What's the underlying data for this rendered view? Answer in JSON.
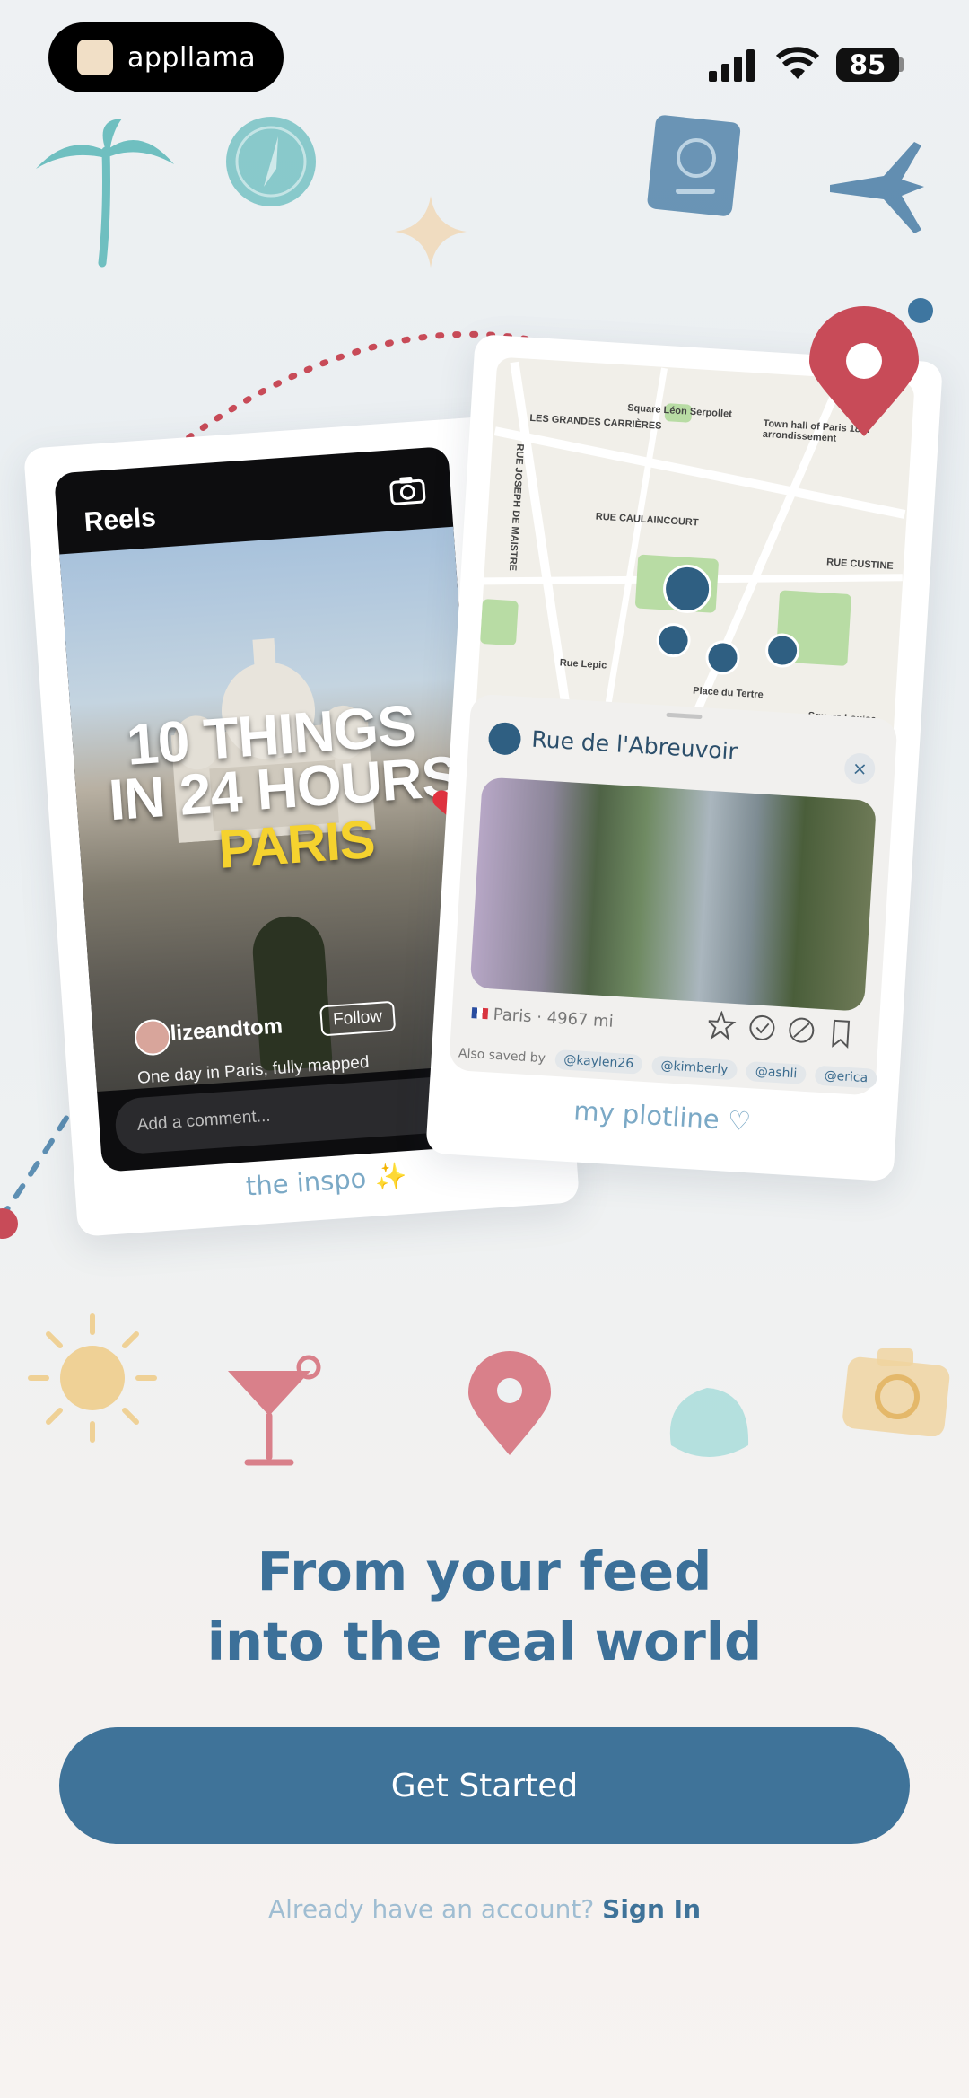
{
  "status_bar": {
    "app_name": "appllama",
    "battery": "85"
  },
  "inspo_card": {
    "reels_title": "Reels",
    "headline_line1": "10 THINGS",
    "headline_line2": "IN 24 HOURS",
    "headline_line3": "PARIS",
    "username": "lizeandtom",
    "follow_label": "Follow",
    "caption": "One day in Paris, fully mapped",
    "comment_placeholder": "Add a comment...",
    "label": "the inspo ✨"
  },
  "plot_card": {
    "map_labels": [
      "Square Léon Serpollet",
      "LES GRANDES CARRIÈRES",
      "Town hall of Paris 18th arrondissement",
      "RUE CAULAINCOURT",
      "RUE CUSTINE",
      "Rue Lepic",
      "Place du Tertre",
      "Square Louise Michel",
      "RUE JOSEPH DE MAISTRE"
    ],
    "place_title": "Rue de l'Abreuvoir",
    "close_label": "×",
    "location": "Paris",
    "distance": "4967 mi",
    "saved_by_label": "Also saved by",
    "saved_by": [
      "@kaylen26",
      "@kimberly",
      "@ashli",
      "@erica"
    ],
    "label": "my plotline ♡"
  },
  "headline": {
    "line1": "From your feed",
    "line2": "into the real world"
  },
  "cta": {
    "label": "Get Started"
  },
  "signin": {
    "prompt": "Already have an account?",
    "link": "Sign In"
  },
  "colors": {
    "accent": "#3f7399",
    "coral": "#c84b58",
    "teal": "#6fbfc0",
    "gold": "#e9c47a"
  }
}
